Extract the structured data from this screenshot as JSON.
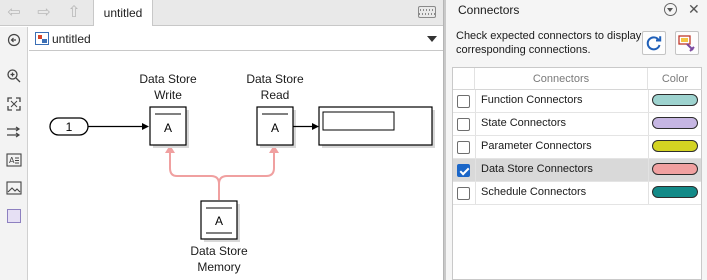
{
  "editor": {
    "tab_label": "untitled",
    "address": "untitled"
  },
  "blocks": {
    "inport_value": "1",
    "write": {
      "line1": "Data Store",
      "line2": "Write",
      "glyph": "A"
    },
    "read": {
      "line1": "Data Store",
      "line2": "Read",
      "glyph": "A"
    },
    "memory": {
      "line1": "Data Store",
      "line2": "Memory",
      "glyph": "A"
    }
  },
  "panel": {
    "title": "Connectors",
    "help_text": "Check expected connectors to display corresponding connections.",
    "columns": {
      "connectors": "Connectors",
      "color": "Color"
    },
    "rows": [
      {
        "label": "Function Connectors",
        "checked": false,
        "color": "#9ed3cf"
      },
      {
        "label": "State Connectors",
        "checked": false,
        "color": "#c6b6e3"
      },
      {
        "label": "Parameter Connectors",
        "checked": false,
        "color": "#d3d322"
      },
      {
        "label": "Data Store Connectors",
        "checked": true,
        "color": "#f0a0a0"
      },
      {
        "label": "Schedule Connectors",
        "checked": false,
        "color": "#138a88"
      }
    ]
  },
  "icons": {
    "back": "back-arrow-icon",
    "forward": "forward-arrow-icon",
    "up": "up-arrow-icon",
    "keyboard": "keyboard-icon",
    "menu": "panel-menu-icon",
    "close": "close-icon",
    "refresh": "refresh-icon",
    "highlight": "highlight-icon"
  }
}
